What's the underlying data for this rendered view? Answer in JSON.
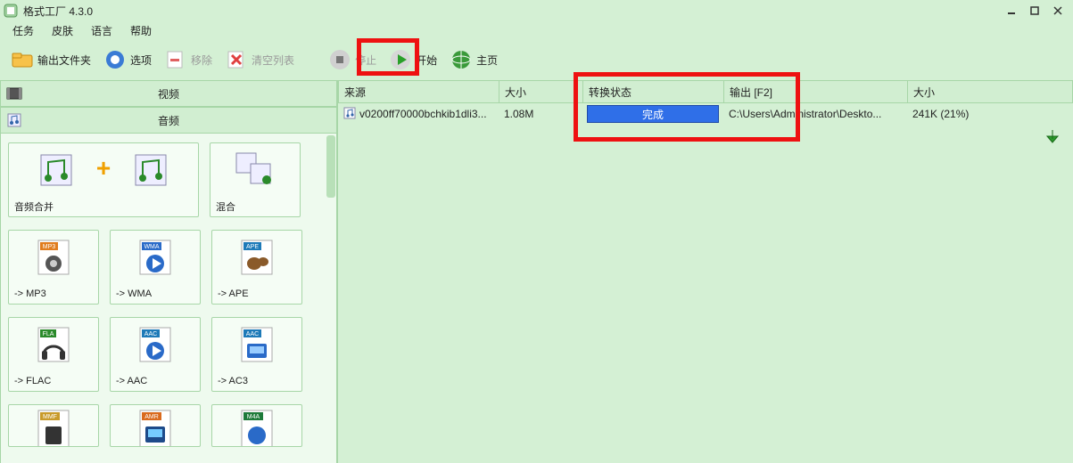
{
  "title": "格式工厂 4.3.0",
  "menu": {
    "task": "任务",
    "skin": "皮肤",
    "lang": "语言",
    "help": "帮助"
  },
  "toolbar": {
    "out_folder": "输出文件夹",
    "options": "选项",
    "remove": "移除",
    "clear": "清空列表",
    "stop": "停止",
    "start": "开始",
    "home": "主页"
  },
  "accordion": {
    "video": "视频",
    "audio": "音频"
  },
  "audio_tiles": {
    "merge": "音频合并",
    "mix": "混合",
    "mp3": "-> MP3",
    "wma": "-> WMA",
    "ape": "-> APE",
    "flac": "-> FLAC",
    "aac": "-> AAC",
    "ac3": "-> AC3",
    "mmf": "",
    "amr": "",
    "m4a": "",
    "badge_mp3": "MP3",
    "badge_wma": "WMA",
    "badge_ape": "APE",
    "badge_fla": "FLA",
    "badge_aac": "AAC",
    "badge_aac2": "AAC",
    "badge_mmf": "MMF",
    "badge_amr": "AMR",
    "badge_m4a": "M4A"
  },
  "columns": {
    "src": "来源",
    "size": "大小",
    "status": "转换状态",
    "out": "输出 [F2]",
    "size2": "大小"
  },
  "row": {
    "src": "v0200ff70000bchkib1dli3...",
    "size": "1.08M",
    "status": "完成",
    "out": "C:\\Users\\Administrator\\Deskto...",
    "size2": "241K (21%)"
  }
}
